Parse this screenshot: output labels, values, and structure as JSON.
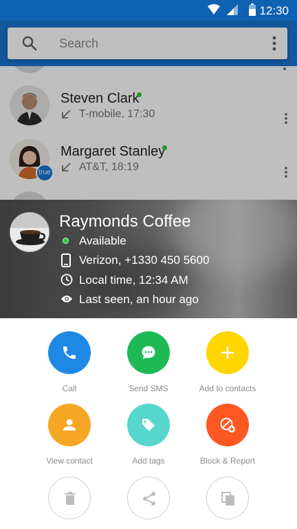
{
  "status_bar": {
    "time": "12:30"
  },
  "search": {
    "placeholder": "Search"
  },
  "contacts": [
    {
      "name": "Steven Clark",
      "sub": "T-mobile, 17:30",
      "online": true
    },
    {
      "name": "Margaret Stanley",
      "sub": "AT&T, 18:19",
      "online": true,
      "badge": "true"
    }
  ],
  "card": {
    "name": "Raymonds Coffee",
    "status": "Available",
    "carrier_number": "Verizon, +1330 450 5600",
    "local_time": "Local time, 12:34 AM",
    "last_seen": "Last seen, an hour ago"
  },
  "actions": {
    "call": {
      "label": "Call",
      "color": "#1e88e5"
    },
    "sms": {
      "label": "Send SMS",
      "color": "#1db954"
    },
    "add_contact": {
      "label": "Add to contacts",
      "color": "#ffd600"
    },
    "view_contact": {
      "label": "View contact",
      "color": "#f5a623"
    },
    "add_tags": {
      "label": "Add tags",
      "color": "#56d6cc"
    },
    "block_report": {
      "label": "Block & Report",
      "color": "#ff5722"
    }
  }
}
